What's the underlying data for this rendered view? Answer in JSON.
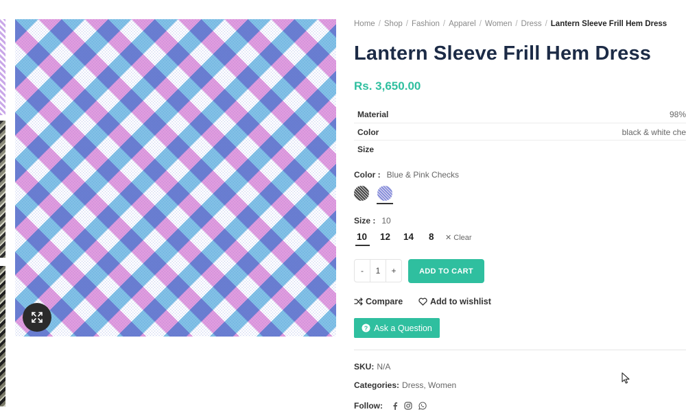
{
  "breadcrumb": {
    "home": "Home",
    "shop": "Shop",
    "fashion": "Fashion",
    "apparel": "Apparel",
    "women": "Women",
    "dress": "Dress",
    "current": "Lantern Sleeve Frill Hem Dress",
    "separator": "/"
  },
  "product": {
    "title": "Lantern Sleeve Frill Hem Dress",
    "price": "Rs. 3,650.00"
  },
  "attributes": [
    {
      "name": "Material",
      "value": "98%"
    },
    {
      "name": "Color",
      "value": "black & white che"
    },
    {
      "name": "Size",
      "value": ""
    }
  ],
  "color": {
    "label": "Color :",
    "selected": "Blue & Pink Checks",
    "swatches": [
      "black-white-check",
      "blue-pink-check"
    ]
  },
  "size": {
    "label": "Size :",
    "selected": "10",
    "options": [
      "10",
      "12",
      "14",
      "8"
    ],
    "clear_label": "Clear"
  },
  "cart": {
    "minus": "-",
    "quantity": "1",
    "plus": "+",
    "add_label": "ADD TO CART"
  },
  "actions": {
    "compare_label": "Compare",
    "wishlist_label": "Add to wishlist",
    "ask_label": "Ask a Question"
  },
  "meta": {
    "sku_label": "SKU:",
    "sku_value": "N/A",
    "categories_label": "Categories:",
    "categories_value": "Dress, Women",
    "follow_label": "Follow:"
  },
  "colors": {
    "accent": "#2fbf9f",
    "title": "#1c2b46",
    "pattern_pink": "#c84fc4",
    "pattern_blue": "#1f8fd1",
    "pattern_purple": "#6d6fd0"
  },
  "icons": [
    "expand-icon",
    "shuffle-icon",
    "heart-icon",
    "question-icon",
    "facebook-icon",
    "instagram-icon",
    "whatsapp-icon",
    "cursor-icon"
  ]
}
